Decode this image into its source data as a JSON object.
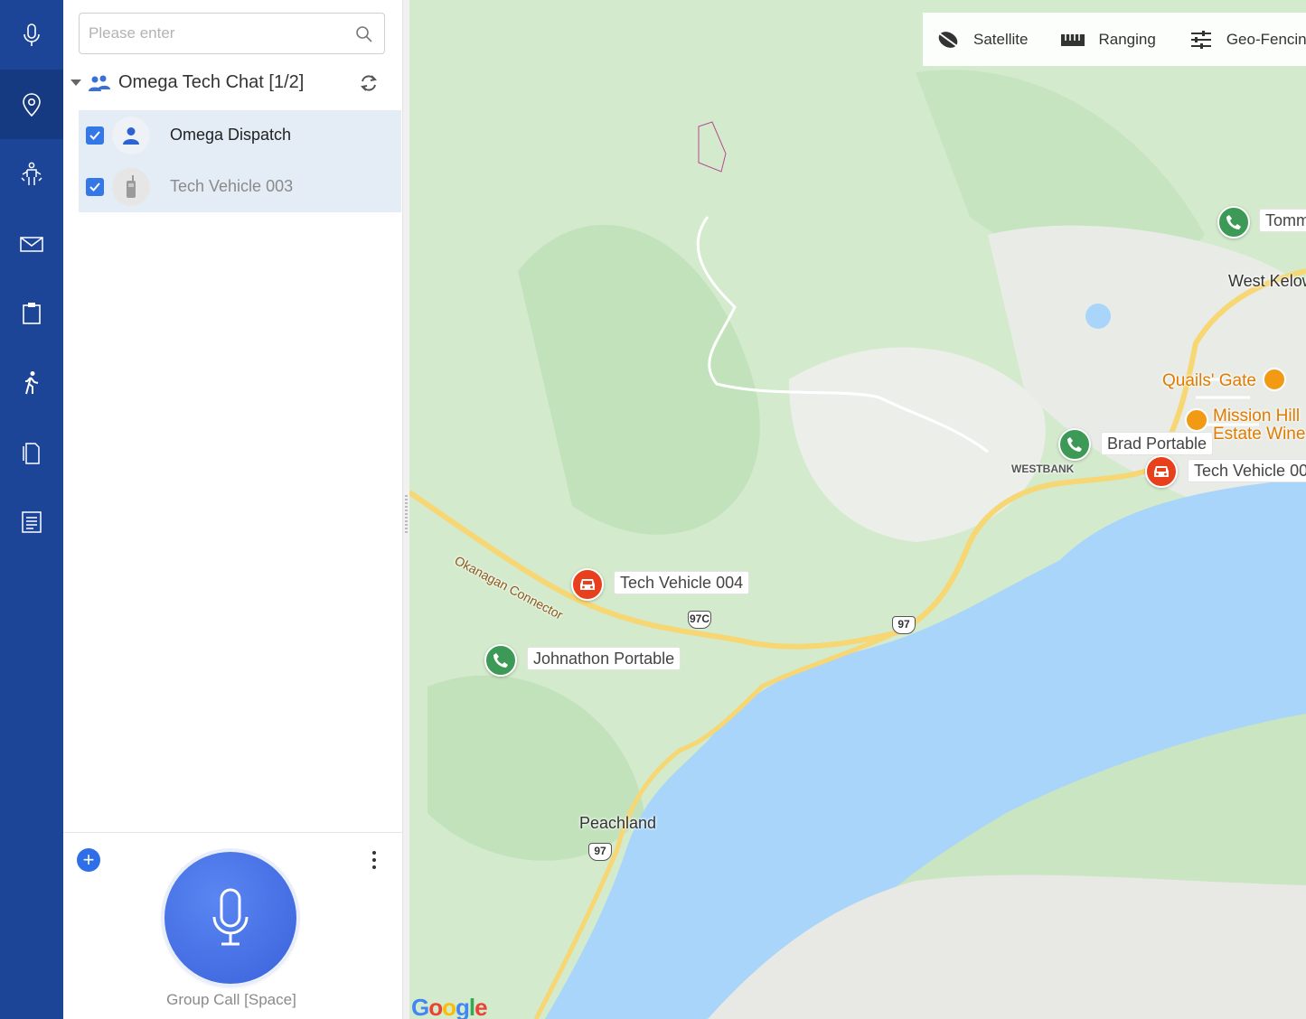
{
  "nav": {
    "items": [
      {
        "name": "voice",
        "icon": "microphone-icon",
        "active": false
      },
      {
        "name": "map",
        "icon": "location-pin-icon",
        "active": true
      },
      {
        "name": "sos",
        "icon": "person-alert-icon",
        "active": false
      },
      {
        "name": "messages",
        "icon": "envelope-icon",
        "active": false
      },
      {
        "name": "tasks",
        "icon": "clipboard-icon",
        "active": false
      },
      {
        "name": "patrol",
        "icon": "walking-person-icon",
        "active": false
      },
      {
        "name": "files",
        "icon": "document-icon",
        "active": false
      },
      {
        "name": "logs",
        "icon": "report-icon",
        "active": false
      }
    ]
  },
  "panel": {
    "search": {
      "placeholder": "Please enter"
    },
    "group": {
      "name": "Omega Tech Chat",
      "count": "[1/2]"
    },
    "members": [
      {
        "name": "Omega Dispatch",
        "type": "dispatcher",
        "checked": true,
        "online": true
      },
      {
        "name": "Tech Vehicle 003",
        "type": "radio",
        "checked": true,
        "online": false
      }
    ],
    "ptt_label": "Group Call [Space]"
  },
  "map": {
    "toolbar": {
      "satellite": "Satellite",
      "ranging": "Ranging",
      "geofencing": "Geo-Fencing"
    },
    "markers": [
      {
        "label": "Tomm",
        "type": "phone"
      },
      {
        "label": "Brad Portable",
        "type": "phone"
      },
      {
        "label": "Tech Vehicle 00",
        "type": "car"
      },
      {
        "label": "Tech Vehicle 004",
        "type": "car"
      },
      {
        "label": "Johnathon Portable",
        "type": "phone"
      }
    ],
    "places": {
      "west_kelowna": "West Kelow",
      "westbank": "WESTBANK",
      "peachland": "Peachland",
      "okanagan_connector": "Okanagan Connector",
      "quails_gate": "Quails' Gate",
      "mission_hill_1": "Mission Hill",
      "mission_hill_2": "Estate Wine"
    },
    "shields": {
      "hwy_97c": "97C",
      "hwy_97a": "97",
      "hwy_97b": "97"
    },
    "attribution": "Google",
    "colors": {
      "land": "#d6ebd1",
      "water": "#a9d5fb",
      "road_major": "#f7d674",
      "phone_marker": "#3c9a56",
      "car_marker": "#e8401c",
      "nav": "#1d4597"
    }
  }
}
